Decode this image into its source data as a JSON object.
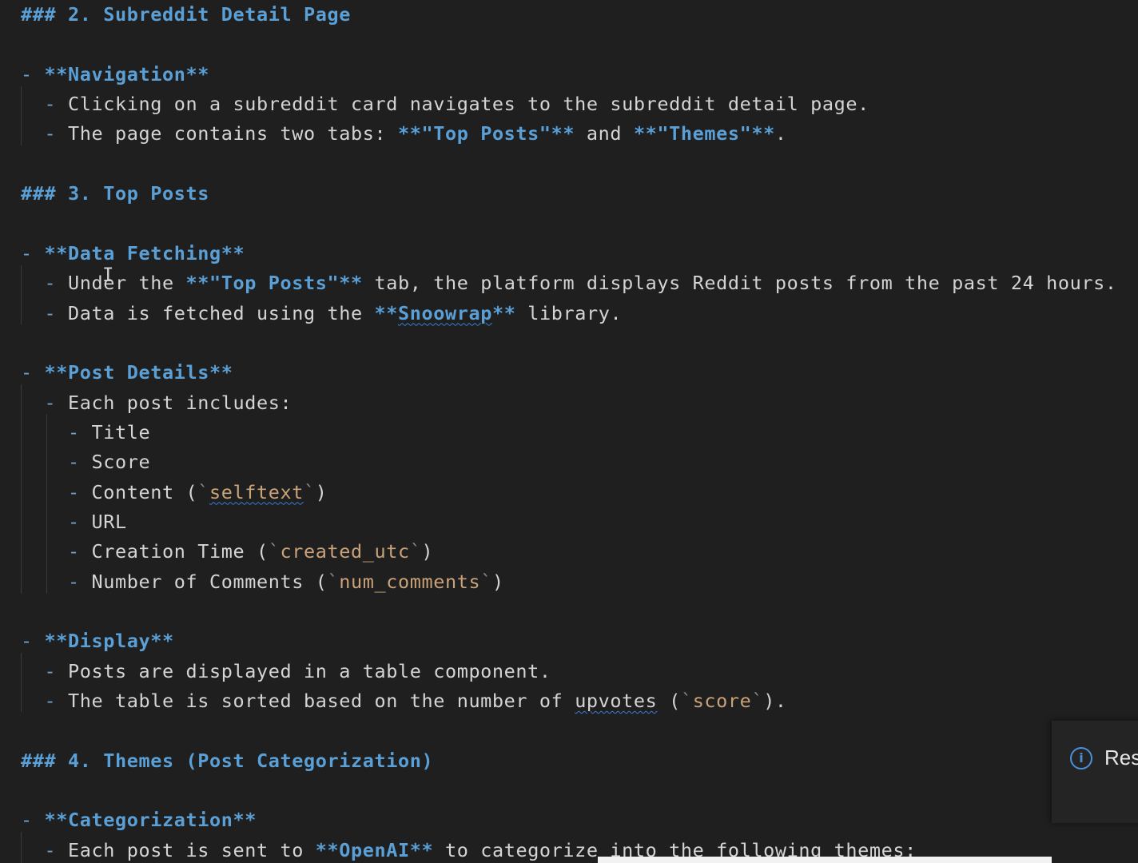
{
  "document": {
    "lines": [
      {
        "segments": [
          {
            "t": "### 2. Subreddit Detail Page",
            "c": "tok-heading"
          }
        ]
      },
      {
        "segments": []
      },
      {
        "segments": [
          {
            "t": "- ",
            "c": "tok-dash"
          },
          {
            "t": "**Navigation**",
            "c": "tok-bold"
          }
        ]
      },
      {
        "segments": [
          {
            "t": "  - ",
            "c": "tok-dash"
          },
          {
            "t": "Clicking on a subreddit card navigates to the subreddit detail page."
          }
        ]
      },
      {
        "segments": [
          {
            "t": "  - ",
            "c": "tok-dash"
          },
          {
            "t": "The page contains two tabs: "
          },
          {
            "t": "**\"Top Posts\"**",
            "c": "tok-bold"
          },
          {
            "t": " and "
          },
          {
            "t": "**\"Themes\"**",
            "c": "tok-bold"
          },
          {
            "t": "."
          }
        ]
      },
      {
        "segments": []
      },
      {
        "segments": [
          {
            "t": "### 3. Top Posts",
            "c": "tok-heading"
          }
        ]
      },
      {
        "segments": []
      },
      {
        "segments": [
          {
            "t": "- ",
            "c": "tok-dash"
          },
          {
            "t": "**Data Fetching**",
            "c": "tok-bold"
          }
        ]
      },
      {
        "segments": [
          {
            "t": "  - ",
            "c": "tok-dash"
          },
          {
            "t": "Under the "
          },
          {
            "t": "**\"Top Posts\"**",
            "c": "tok-bold"
          },
          {
            "t": " tab, the platform displays Reddit posts from the past 24 hours."
          }
        ]
      },
      {
        "segments": [
          {
            "t": "  - ",
            "c": "tok-dash"
          },
          {
            "t": "Data is fetched using the "
          },
          {
            "t": "**",
            "c": "tok-bold"
          },
          {
            "t": "Snoowrap",
            "c": "tok-bold squiggle"
          },
          {
            "t": "**",
            "c": "tok-bold"
          },
          {
            "t": " library."
          }
        ]
      },
      {
        "segments": []
      },
      {
        "segments": [
          {
            "t": "- ",
            "c": "tok-dash"
          },
          {
            "t": "**Post Details**",
            "c": "tok-bold"
          }
        ]
      },
      {
        "segments": [
          {
            "t": "  - ",
            "c": "tok-dash"
          },
          {
            "t": "Each post includes:"
          }
        ]
      },
      {
        "segments": [
          {
            "t": "    - ",
            "c": "tok-dash"
          },
          {
            "t": "Title"
          }
        ]
      },
      {
        "segments": [
          {
            "t": "    - ",
            "c": "tok-dash"
          },
          {
            "t": "Score"
          }
        ]
      },
      {
        "segments": [
          {
            "t": "    - ",
            "c": "tok-dash"
          },
          {
            "t": "Content ("
          },
          {
            "t": "`",
            "c": "tok-tick"
          },
          {
            "t": "selftext",
            "c": "tok-code squiggle"
          },
          {
            "t": "`",
            "c": "tok-tick"
          },
          {
            "t": ")"
          }
        ]
      },
      {
        "segments": [
          {
            "t": "    - ",
            "c": "tok-dash"
          },
          {
            "t": "URL"
          }
        ]
      },
      {
        "segments": [
          {
            "t": "    - ",
            "c": "tok-dash"
          },
          {
            "t": "Creation Time ("
          },
          {
            "t": "`",
            "c": "tok-tick"
          },
          {
            "t": "created_utc",
            "c": "tok-code"
          },
          {
            "t": "`",
            "c": "tok-tick"
          },
          {
            "t": ")"
          }
        ]
      },
      {
        "segments": [
          {
            "t": "    - ",
            "c": "tok-dash"
          },
          {
            "t": "Number of Comments ("
          },
          {
            "t": "`",
            "c": "tok-tick"
          },
          {
            "t": "num_comments",
            "c": "tok-code"
          },
          {
            "t": "`",
            "c": "tok-tick"
          },
          {
            "t": ")"
          }
        ]
      },
      {
        "segments": []
      },
      {
        "segments": [
          {
            "t": "- ",
            "c": "tok-dash"
          },
          {
            "t": "**Display**",
            "c": "tok-bold"
          }
        ]
      },
      {
        "segments": [
          {
            "t": "  - ",
            "c": "tok-dash"
          },
          {
            "t": "Posts are displayed in a table component."
          }
        ]
      },
      {
        "segments": [
          {
            "t": "  - ",
            "c": "tok-dash"
          },
          {
            "t": "The table is sorted based on the number of "
          },
          {
            "t": "upvotes",
            "c": "squiggle"
          },
          {
            "t": " ("
          },
          {
            "t": "`",
            "c": "tok-tick"
          },
          {
            "t": "score",
            "c": "tok-code"
          },
          {
            "t": "`",
            "c": "tok-tick"
          },
          {
            "t": ")."
          }
        ]
      },
      {
        "segments": []
      },
      {
        "segments": [
          {
            "t": "### 4. Themes (Post Categorization)",
            "c": "tok-heading"
          }
        ]
      },
      {
        "segments": []
      },
      {
        "segments": [
          {
            "t": "- ",
            "c": "tok-dash"
          },
          {
            "t": "**Categorization**",
            "c": "tok-bold"
          }
        ]
      },
      {
        "segments": [
          {
            "t": "  - ",
            "c": "tok-dash"
          },
          {
            "t": "Each post is sent to "
          },
          {
            "t": "**OpenAI**",
            "c": "tok-bold"
          },
          {
            "t": " to categorize into the following themes:"
          }
        ]
      }
    ]
  },
  "notification": {
    "icon": "info-icon",
    "icon_glyph": "i",
    "text": "Res"
  },
  "colors": {
    "background": "#1f1f1f",
    "text": "#d4d4d4",
    "accent": "#5a9fd6",
    "code": "#c9a27a"
  }
}
